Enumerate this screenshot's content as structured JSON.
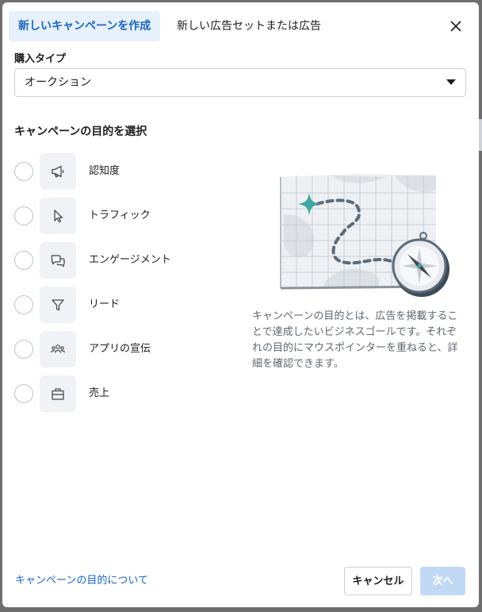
{
  "tabs": {
    "new_campaign": "新しいキャンペーンを作成",
    "new_ad_set_or_ad": "新しい広告セットまたは広告"
  },
  "buying_type": {
    "label": "購入タイプ",
    "value": "オークション"
  },
  "objectives": {
    "heading": "キャンペーンの目的を選択",
    "items": [
      {
        "label": "認知度",
        "icon": "megaphone-icon"
      },
      {
        "label": "トラフィック",
        "icon": "cursor-icon"
      },
      {
        "label": "エンゲージメント",
        "icon": "chat-bubbles-icon"
      },
      {
        "label": "リード",
        "icon": "filter-icon"
      },
      {
        "label": "アプリの宣伝",
        "icon": "people-icon"
      },
      {
        "label": "売上",
        "icon": "shopping-bag-icon"
      }
    ]
  },
  "description": "キャンペーンの目的とは、広告を掲載することで達成したいビジネスゴールです。それぞれの目的にマウスポインターを重ねると、詳細を確認できます。",
  "footer": {
    "learn_link": "キャンペーンの目的について",
    "cancel_label": "キャンセル",
    "next_label": "次へ"
  },
  "colors": {
    "accent": "#1a66c0",
    "active_tab_bg": "#e7f0fb",
    "disabled_button": "#c2d9f5",
    "illustration_teal": "#3ea7a1"
  }
}
